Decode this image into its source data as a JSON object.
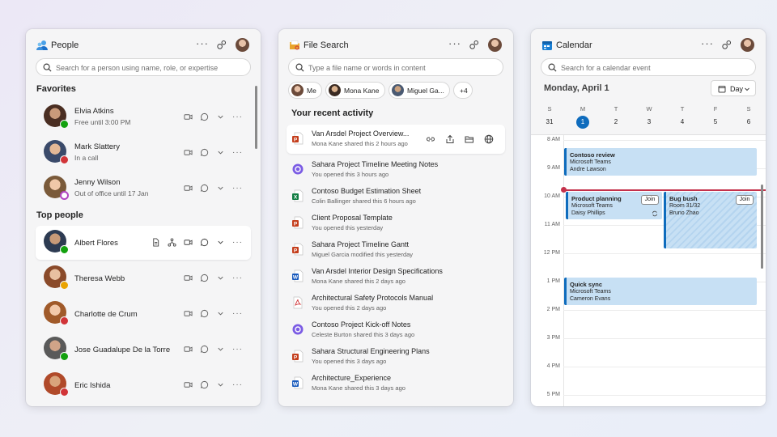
{
  "people": {
    "title": "People",
    "search_placeholder": "Search for a person using name, role, or expertise",
    "favorites_label": "Favorites",
    "top_label": "Top people",
    "favorites": [
      {
        "name": "Elvia Atkins",
        "sub": "Free until 3:00 PM",
        "status": "available"
      },
      {
        "name": "Mark Slattery",
        "sub": "In a call",
        "status": "busy"
      },
      {
        "name": "Jenny Wilson",
        "sub": "Out of office until 17 Jan",
        "status": "ooo"
      }
    ],
    "top": [
      {
        "name": "Albert Flores",
        "status": "available"
      },
      {
        "name": "Theresa Webb",
        "status": "away"
      },
      {
        "name": "Charlotte de Crum",
        "status": "dnd"
      },
      {
        "name": "Jose Guadalupe De la Torre",
        "status": "available"
      },
      {
        "name": "Eric Ishida",
        "status": "busy"
      }
    ]
  },
  "files": {
    "title": "File Search",
    "search_placeholder": "Type a file name or words in content",
    "chips": [
      "Me",
      "Mona Kane",
      "Miguel Ga...",
      "+4"
    ],
    "recent_label": "Your recent activity",
    "items": [
      {
        "name": "Van Arsdel Project Overview...",
        "sub": "Mona Kane shared this 2 hours ago",
        "type": "ppt"
      },
      {
        "name": "Sahara Project Timeline Meeting Notes",
        "sub": "You opened this 3 hours ago",
        "type": "loop"
      },
      {
        "name": "Contoso Budget Estimation Sheet",
        "sub": "Colin Ballinger shared this 6 hours ago",
        "type": "xls"
      },
      {
        "name": "Client Proposal Template",
        "sub": "You opened this yesterday",
        "type": "ppt"
      },
      {
        "name": "Sahara Project Timeline Gantt",
        "sub": "Miguel Garcia modified this yesterday",
        "type": "ppt"
      },
      {
        "name": "Van Arsdel Interior Design Specifications",
        "sub": "Mona Kane shared this 2 days ago",
        "type": "doc"
      },
      {
        "name": "Architectural Safety Protocols Manual",
        "sub": "You opened this 2 days ago",
        "type": "pdf"
      },
      {
        "name": "Contoso Project Kick-off  Notes",
        "sub": "Celeste Burton shared this 3 days ago",
        "type": "loop"
      },
      {
        "name": "Sahara Structural Engineering Plans",
        "sub": "You opened this 3 days ago",
        "type": "ppt"
      },
      {
        "name": "Architecture_Experience",
        "sub": "Mona Kane shared this 3 days ago",
        "type": "doc"
      }
    ]
  },
  "calendar": {
    "title": "Calendar",
    "search_placeholder": "Search for a calendar event",
    "date_heading": "Monday, April 1",
    "view_label": "Day",
    "weekdays": [
      "S",
      "M",
      "T",
      "W",
      "T",
      "F",
      "S"
    ],
    "days": [
      "31",
      "1",
      "2",
      "3",
      "4",
      "5",
      "6"
    ],
    "hours": [
      "8 AM",
      "9 AM",
      "10 AM",
      "11 AM",
      "12 PM",
      "1 PM",
      "2 PM",
      "3 PM",
      "4 PM",
      "5 PM"
    ],
    "events": {
      "contoso": {
        "title": "Contoso review",
        "line1": "Microsoft Teams",
        "line2": "Andre Lawson"
      },
      "planning": {
        "title": "Product planning",
        "line1": "Microsoft Teams",
        "line2": "Daisy Phillips",
        "join": "Join"
      },
      "bug": {
        "title": "Bug bush",
        "line1": "Room 31/32",
        "line2": "Bruno Zhao",
        "join": "Join"
      },
      "sync": {
        "title": "Quick sync",
        "line1": "Microsoft Teams",
        "line2": "Cameron Evans"
      }
    }
  },
  "colors": {
    "accent": "#0f6cbd",
    "available": "#13a10e",
    "busy": "#d13438",
    "away": "#eaa300",
    "ooo": "#b146c2",
    "now": "#c4314b"
  }
}
